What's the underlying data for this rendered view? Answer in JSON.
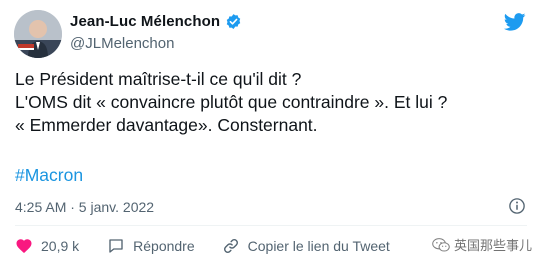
{
  "author": {
    "name": "Jean-Luc Mélenchon",
    "handle": "@JLMelenchon"
  },
  "tweet": {
    "lines": [
      "Le Président maîtrise-t-il ce qu'il dit ?",
      "L'OMS dit « convaincre plutôt que contraindre ». Et lui ?",
      "« Emmerder davantage». Consternant."
    ],
    "hashtag": "#Macron",
    "timestamp": "4:25 AM · 5 janv. 2022"
  },
  "actions": {
    "likes": "20,9 k",
    "reply_label": "Répondre",
    "copy_link_label": "Copier le lien du Tweet"
  },
  "watermark": "英国那些事儿",
  "colors": {
    "twitter_blue": "#1d9bf0",
    "hashtag": "#1b95e0",
    "like_red": "#f91880",
    "secondary_text": "#536471"
  },
  "icons": {
    "verified": "verified-badge-icon",
    "brand": "twitter-bird-icon",
    "info": "info-icon",
    "like": "heart-icon",
    "reply": "speech-bubble-icon",
    "copy": "link-icon",
    "watermark": "wechat-icon"
  }
}
